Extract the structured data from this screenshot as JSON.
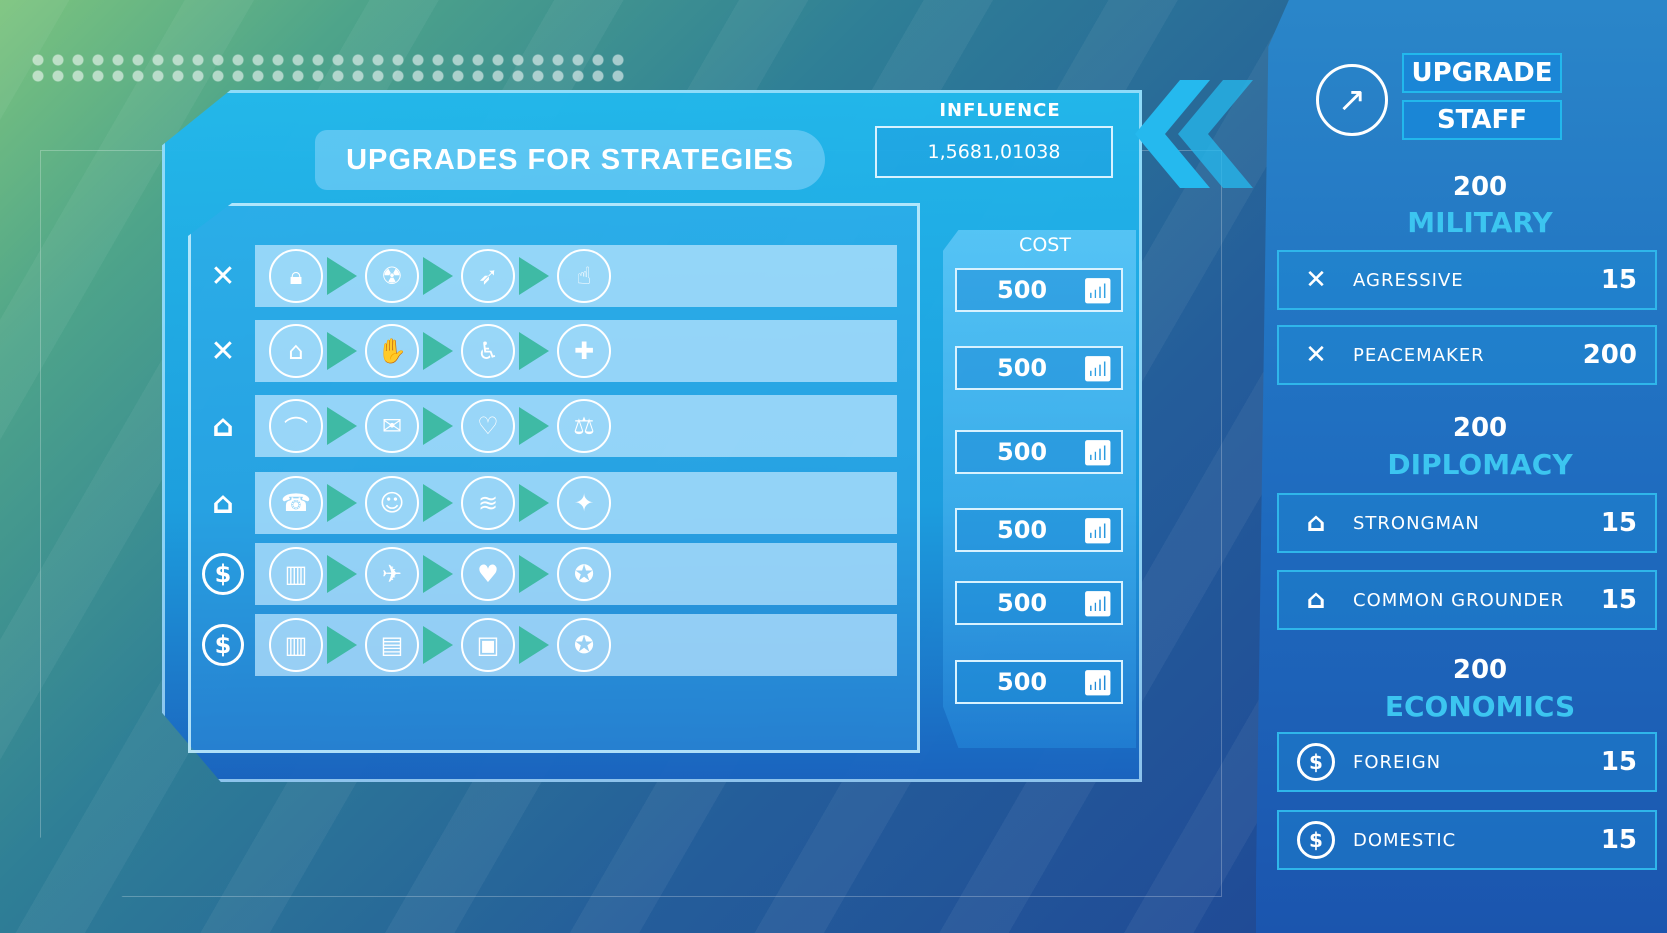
{
  "title": "UPGRADES FOR STRATEGIES",
  "influence": {
    "label": "INFLUENCE",
    "value": "1,5681,01038"
  },
  "cost_label": "COST",
  "rows": [
    {
      "category_icon": "swords-icon",
      "nodes": [
        "lock-icon",
        "radiation-icon",
        "rocket-icon",
        "hand-coin-icon"
      ],
      "cost": "500"
    },
    {
      "category_icon": "swords-icon",
      "nodes": [
        "capitol-building-icon",
        "handshake-icon",
        "wheelchair-icon",
        "ambulance-icon"
      ],
      "cost": "500"
    },
    {
      "category_icon": "bank-icon",
      "nodes": [
        "graduation-cap-icon",
        "diploma-icon",
        "relationship-icon",
        "gavel-icon"
      ],
      "cost": "500"
    },
    {
      "category_icon": "bank-icon",
      "nodes": [
        "phone-icon",
        "people-icon",
        "wifi-icon",
        "lightbulb-icon"
      ],
      "cost": "500"
    },
    {
      "category_icon": "dollar-icon",
      "nodes": [
        "growth-chart-icon",
        "airplane-icon",
        "hand-heart-icon",
        "award-badge-icon"
      ],
      "cost": "500"
    },
    {
      "category_icon": "dollar-icon",
      "nodes": [
        "growth-chart-icon",
        "presentation-icon",
        "monitor-icon",
        "award-badge-icon"
      ],
      "cost": "500"
    }
  ],
  "side": {
    "upgrade_label": "UPGRADE",
    "staff_label": "STAFF",
    "sections": [
      {
        "points": "200",
        "name": "MILITARY",
        "items": [
          {
            "icon": "swords-icon",
            "name": "AGRESSIVE",
            "value": "15"
          },
          {
            "icon": "swords-icon",
            "name": "PEACEMAKER",
            "value": "200"
          }
        ]
      },
      {
        "points": "200",
        "name": "DIPLOMACY",
        "items": [
          {
            "icon": "bank-icon",
            "name": "STRONGMAN",
            "value": "15"
          },
          {
            "icon": "bank-icon",
            "name": "COMMON GROUNDER",
            "value": "15"
          }
        ]
      },
      {
        "points": "200",
        "name": "ECONOMICS",
        "items": [
          {
            "icon": "dollar-icon",
            "name": "FOREIGN",
            "value": "15"
          },
          {
            "icon": "dollar-icon",
            "name": "DOMESTIC",
            "value": "15"
          }
        ]
      }
    ]
  },
  "colors": {
    "accent": "#22b8ec",
    "arrow": "#3fbaa5",
    "section_name": "#3cc5f0"
  }
}
